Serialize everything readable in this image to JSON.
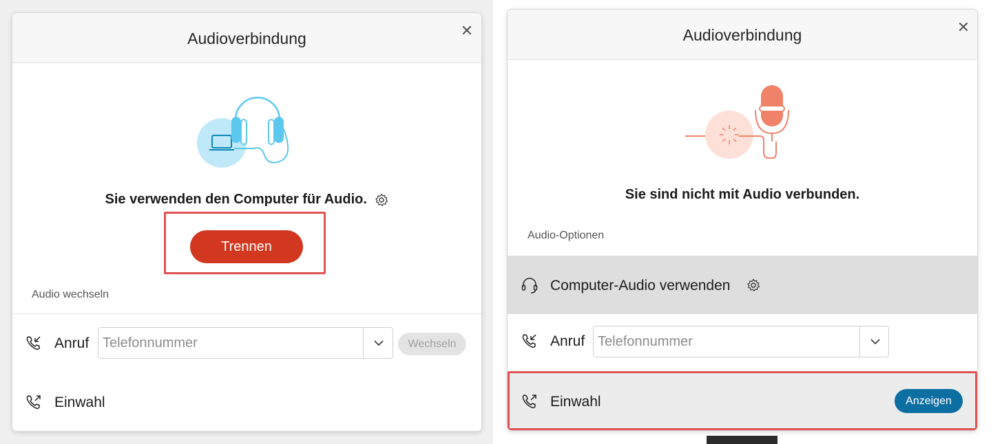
{
  "left_dialog": {
    "title": "Audioverbindung",
    "close_icon": "close-icon",
    "status": "Sie verwenden den Computer für Audio.",
    "disconnect_label": "Trennen",
    "switch_section_label": "Audio wechseln",
    "call_label": "Anruf",
    "phone_placeholder": "Telefonnummer",
    "switch_button_label": "Wechseln",
    "dial_in_label": "Einwahl"
  },
  "right_dialog": {
    "title": "Audioverbindung",
    "close_icon": "close-icon",
    "status": "Sie sind nicht mit Audio verbunden.",
    "options_label": "Audio-Optionen",
    "computer_audio_label": "Computer-Audio verwenden",
    "call_label": "Anruf",
    "phone_placeholder": "Telefonnummer",
    "dial_in_label": "Einwahl",
    "show_button_label": "Anzeigen"
  },
  "colors": {
    "disconnect_red": "#d2371f",
    "highlight_red": "#e15253",
    "show_blue": "#0d6fa1",
    "headset_cyan": "#5cc8ee",
    "mic_salmon": "#f0826a"
  }
}
